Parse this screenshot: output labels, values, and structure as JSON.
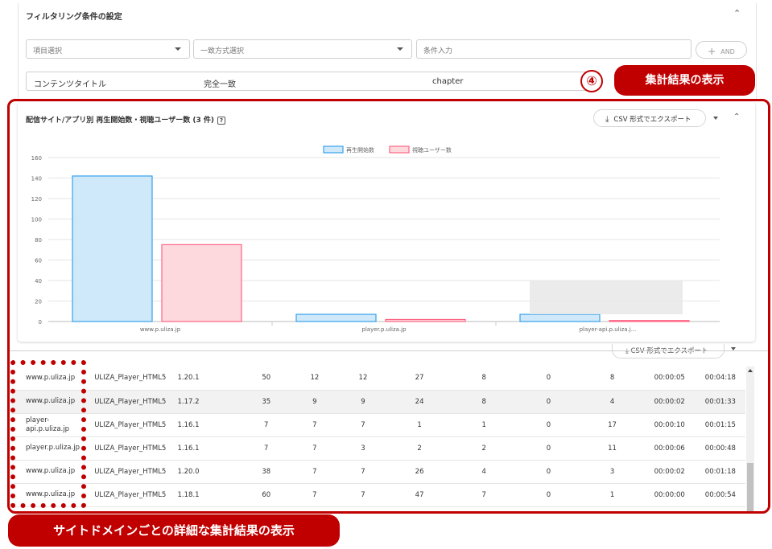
{
  "filter": {
    "title": "フィルタリング条件の設定",
    "collapse_icon": "chevron-up-icon",
    "item_select_placeholder": "項目選択",
    "match_select_placeholder": "一致方式選択",
    "condition_placeholder": "条件入力",
    "and_label": "AND",
    "chip": {
      "field": "コンテンツタイトル",
      "match": "完全一致",
      "value": "chapter"
    }
  },
  "annotations": {
    "step_number": "④",
    "summary_label": "集計結果の表示",
    "detail_label": "サイトドメインごとの詳細な集計結果の表示",
    "accent_color": "#c00000"
  },
  "card": {
    "title": "配信サイト/アプリ別 再生開始数・視聴ユーザー数 (3 件)",
    "help_icon": "?",
    "csv_label": "CSV 形式でエクスポート",
    "ghost_csv_label": "CSV 形式でエクスポート"
  },
  "chart_data": {
    "type": "bar",
    "categories": [
      "www.p.uliza.jp",
      "player.p.uliza.jp",
      "player-api.p.uliza.j..."
    ],
    "series": [
      {
        "name": "再生開始数",
        "values": [
          142,
          7,
          7
        ],
        "color": "#36a2eb",
        "fill": "#cfe9fb"
      },
      {
        "name": "視聴ユーザー数",
        "values": [
          75,
          2,
          1
        ],
        "color": "#ff6384",
        "fill": "#fdd8dd"
      }
    ],
    "yticks": [
      0,
      20,
      40,
      60,
      80,
      100,
      120,
      140,
      160
    ],
    "ylim": [
      0,
      160
    ],
    "legend_position": "top-center",
    "grid": true
  },
  "table": {
    "rows": [
      [
        "www.p.uliza.jp",
        "ULIZA_Player_HTML5",
        "1.20.1",
        "50",
        "12",
        "12",
        "27",
        "8",
        "0",
        "8",
        "00:00:05",
        "00:04:18"
      ],
      [
        "www.p.uliza.jp",
        "ULIZA_Player_HTML5",
        "1.17.2",
        "35",
        "9",
        "9",
        "24",
        "8",
        "0",
        "4",
        "00:00:02",
        "00:01:33"
      ],
      [
        "player-api.p.uliza.jp",
        "ULIZA_Player_HTML5",
        "1.16.1",
        "7",
        "7",
        "7",
        "1",
        "1",
        "0",
        "17",
        "00:00:10",
        "00:01:15"
      ],
      [
        "player.p.uliza.jp",
        "ULIZA_Player_HTML5",
        "1.16.1",
        "7",
        "7",
        "3",
        "2",
        "2",
        "0",
        "11",
        "00:00:06",
        "00:00:48"
      ],
      [
        "www.p.uliza.jp",
        "ULIZA_Player_HTML5",
        "1.20.0",
        "38",
        "7",
        "7",
        "26",
        "4",
        "0",
        "3",
        "00:00:02",
        "00:01:18"
      ],
      [
        "www.p.uliza.jp",
        "ULIZA_Player_HTML5",
        "1.18.1",
        "60",
        "7",
        "7",
        "47",
        "7",
        "0",
        "1",
        "00:00:00",
        "00:00:54"
      ]
    ]
  }
}
